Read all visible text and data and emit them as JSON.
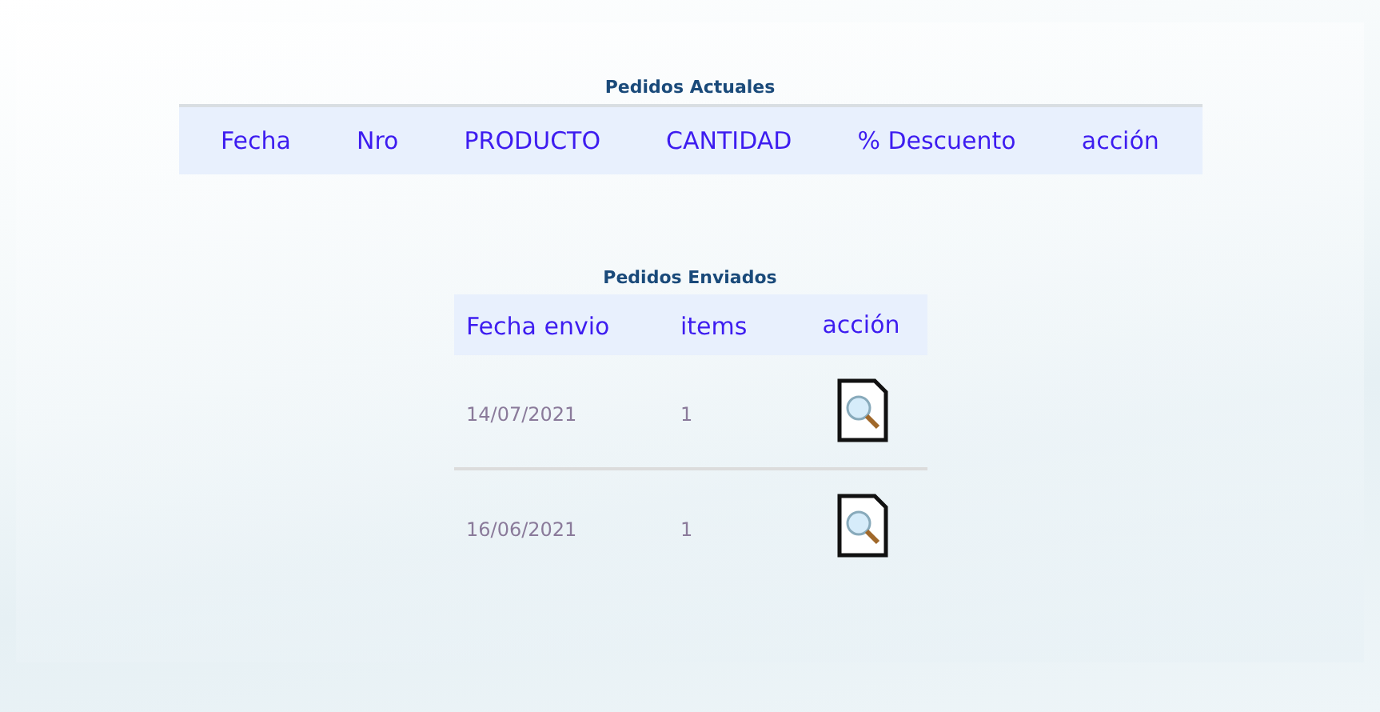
{
  "current_orders": {
    "title": "Pedidos Actuales",
    "columns": [
      "Fecha",
      "Nro",
      "PRODUCTO",
      "CANTIDAD",
      "% Descuento",
      "acción"
    ]
  },
  "sent_orders": {
    "title": "Pedidos Enviados",
    "columns": [
      "Fecha envio",
      "items",
      "acción"
    ],
    "rows": [
      {
        "date": "14/07/2021",
        "items": "1"
      },
      {
        "date": "16/06/2021",
        "items": "1"
      }
    ]
  }
}
